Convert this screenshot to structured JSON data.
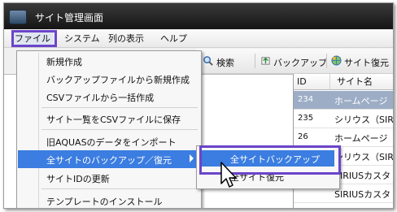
{
  "window": {
    "title": "サイト管理画面",
    "app_icon": "app-logo-icon"
  },
  "menubar": {
    "items": [
      "ファイル",
      "システム",
      "列の表示",
      "ヘルプ"
    ]
  },
  "toolbar": {
    "search": {
      "label": "検索",
      "icon": "search-icon"
    },
    "backup": {
      "label": "バックアップ",
      "icon": "backup-icon"
    },
    "restore": {
      "label": "サイト復元",
      "icon": "globe-icon"
    }
  },
  "file_menu": {
    "items": [
      "新規作成",
      "バックアップファイルから新規作成",
      "CSVファイルから一括作成",
      "サイト一覧をCSVファイルに保存",
      "旧AQUASのデータをインポート",
      "全サイトのバックアップ／復元",
      "サイトIDの更新",
      "テンプレートのインストール"
    ]
  },
  "submenu": {
    "items": [
      "全サイトバックアップ",
      "全サイト復元"
    ]
  },
  "grid": {
    "columns": [
      "ID",
      "サイト名"
    ],
    "rows": [
      {
        "id": "234",
        "name": "ホームページ",
        "selected": true
      },
      {
        "id": "235",
        "name": "シリウス（SIR"
      },
      {
        "id": "26",
        "name": "ホームページ"
      },
      {
        "id": "",
        "name": "シリウス（SIR"
      },
      {
        "id": "",
        "name": "SIRIUSカスタ"
      },
      {
        "id": "",
        "name": "SIRIUSカスタ"
      }
    ]
  },
  "colors": {
    "highlight_outline": "#6b45c9",
    "menu_selection": "#3b7de0",
    "row_selection": "#9dadc6"
  }
}
